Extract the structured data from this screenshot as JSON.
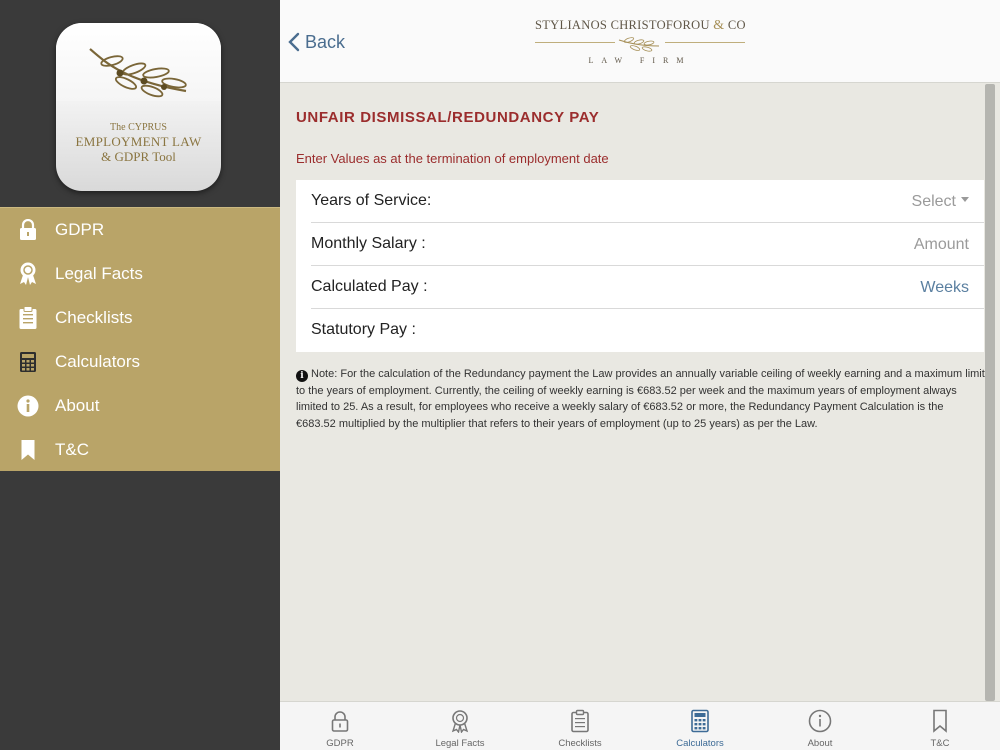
{
  "app_icon": {
    "line1": "The CYPRUS",
    "line2": "EMPLOYMENT LAW",
    "line3": "& GDPR Tool"
  },
  "sidebar": {
    "items": [
      {
        "label": "GDPR",
        "icon": "lock-icon"
      },
      {
        "label": "Legal Facts",
        "icon": "award-ribbon-icon"
      },
      {
        "label": "Checklists",
        "icon": "clipboard-icon"
      },
      {
        "label": "Calculators",
        "icon": "calculator-icon"
      },
      {
        "label": "About",
        "icon": "info-icon"
      },
      {
        "label": "T&C",
        "icon": "bookmark-icon"
      }
    ]
  },
  "header": {
    "back_label": "Back",
    "logo_name": "STYLIANOS CHRISTOFOROU",
    "logo_amp": "&",
    "logo_co": "CO",
    "logo_sub": "LAW FIRM"
  },
  "page": {
    "title": "UNFAIR DISMISSAL/REDUNDANCY PAY",
    "instruction": "Enter Values as at the termination of employment date",
    "rows": [
      {
        "label": "Years of Service:",
        "value": "Select"
      },
      {
        "label": "Monthly Salary :",
        "value": "Amount"
      },
      {
        "label": "Calculated Pay :",
        "value": "Weeks"
      },
      {
        "label": "Statutory Pay :",
        "value": ""
      }
    ],
    "note_icon": "i",
    "note": "Note: For the calculation of the Redundancy payment the Law provides an annually variable ceiling of weekly earning and a maximum limit to the years of employment. Currently, the ceiling of weekly earning is €683.52 per week and the maximum years of employment always limited to 25. As a result, for employees who receive a weekly salary of €683.52 or more, the Redundancy Payment Calculation is the €683.52 multiplied by the multiplier that refers to their years of employment (up to 25 years) as per the Law."
  },
  "tabbar": {
    "tabs": [
      {
        "label": "GDPR",
        "icon": "lock-icon"
      },
      {
        "label": "Legal Facts",
        "icon": "award-ribbon-icon"
      },
      {
        "label": "Checklists",
        "icon": "clipboard-icon"
      },
      {
        "label": "Calculators",
        "icon": "calculator-icon",
        "active": true
      },
      {
        "label": "About",
        "icon": "info-icon"
      },
      {
        "label": "T&C",
        "icon": "bookmark-icon"
      }
    ]
  },
  "colors": {
    "sidebar_bg": "#3a3a3a",
    "menu_gold": "#b9a468",
    "heading_red": "#9b2d2d",
    "link_blue": "#4a6d8f",
    "content_bg": "#e9e8e2"
  }
}
